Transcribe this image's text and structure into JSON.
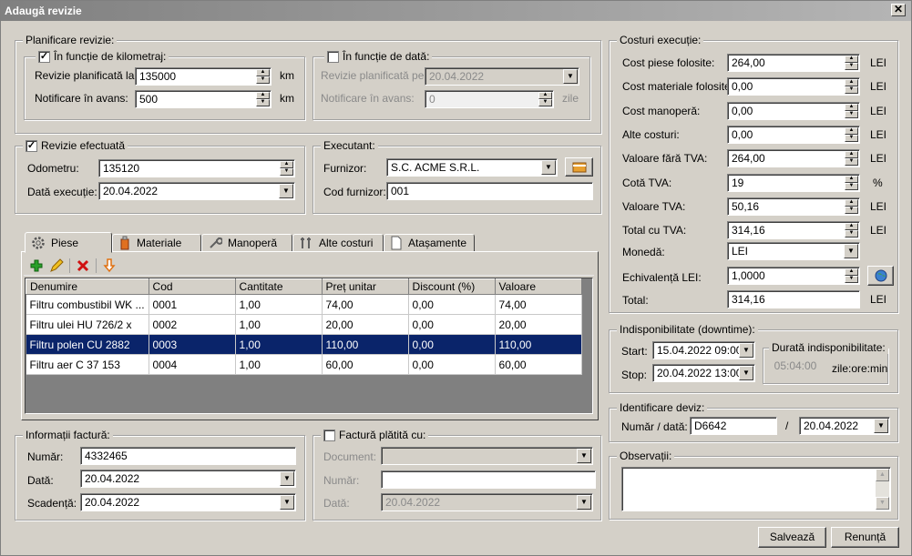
{
  "window": {
    "title": "Adaugă revizie",
    "close": "✕"
  },
  "planificare": {
    "title": "Planificare revizie:",
    "km": {
      "title": "În funcție de kilometraj:",
      "checked": "✓",
      "revizie_label": "Revizie planificată la:",
      "revizie_value": "135000",
      "revizie_unit": "km",
      "notificare_label": "Notificare în avans:",
      "notificare_value": "500",
      "notificare_unit": "km"
    },
    "data": {
      "title": "În funcție de dată:",
      "checked": "",
      "revizie_label": "Revizie planificată pe:",
      "revizie_value": "20.04.2022",
      "notificare_label": "Notificare în avans:",
      "notificare_value": "0",
      "notificare_unit": "zile"
    }
  },
  "efectuata": {
    "title": "Revizie efectuată",
    "checked": "✓",
    "odometru_label": "Odometru:",
    "odometru_value": "135120",
    "data_label": "Dată execuție:",
    "data_value": "20.04.2022"
  },
  "executant": {
    "title": "Executant:",
    "furnizor_label": "Furnizor:",
    "furnizor_value": "S.C. ACME S.R.L.",
    "cod_label": "Cod furnizor:",
    "cod_value": "001"
  },
  "tabs": [
    {
      "label": "Piese",
      "icon": "gear-icon"
    },
    {
      "label": "Materiale",
      "icon": "can-icon"
    },
    {
      "label": "Manoperă",
      "icon": "wrench-icon"
    },
    {
      "label": "Alte costuri",
      "icon": "tools-icon"
    },
    {
      "label": "Atașamente",
      "icon": "document-icon"
    }
  ],
  "grid": {
    "columns": [
      "Denumire",
      "Cod",
      "Cantitate",
      "Preț unitar",
      "Discount (%)",
      "Valoare"
    ],
    "rows": [
      [
        "Filtru combustibil WK ...",
        "0001",
        "1,00",
        "74,00",
        "0,00",
        "74,00"
      ],
      [
        "Filtru ulei HU 726/2 x",
        "0002",
        "1,00",
        "20,00",
        "0,00",
        "20,00"
      ],
      [
        "Filtru polen CU 2882",
        "0003",
        "1,00",
        "110,00",
        "0,00",
        "110,00"
      ],
      [
        "Filtru aer C 37 153",
        "0004",
        "1,00",
        "60,00",
        "0,00",
        "60,00"
      ]
    ],
    "selected_row": 2
  },
  "factura": {
    "title": "Informații factură:",
    "numar_label": "Număr:",
    "numar_value": "4332465",
    "data_label": "Dată:",
    "data_value": "20.04.2022",
    "scadenta_label": "Scadență:",
    "scadenta_value": "20.04.2022"
  },
  "platita": {
    "title": "Factură plătită cu:",
    "checked": "",
    "document_label": "Document:",
    "document_value": "",
    "numar_label": "Număr:",
    "numar_value": "",
    "data_label": "Dată:",
    "data_value": "20.04.2022"
  },
  "costuri": {
    "title": "Costuri execuție:",
    "rows": [
      {
        "label": "Cost piese folosite:",
        "value": "264,00",
        "unit": "LEI"
      },
      {
        "label": "Cost materiale folosite:",
        "value": "0,00",
        "unit": "LEI"
      },
      {
        "label": "Cost manoperă:",
        "value": "0,00",
        "unit": "LEI"
      },
      {
        "label": "Alte costuri:",
        "value": "0,00",
        "unit": "LEI"
      },
      {
        "label": "Valoare fără TVA:",
        "value": "264,00",
        "unit": "LEI"
      },
      {
        "label": "Cotă TVA:",
        "value": "19",
        "unit": "%"
      },
      {
        "label": "Valoare TVA:",
        "value": "50,16",
        "unit": "LEI"
      },
      {
        "label": "Total cu TVA:",
        "value": "314,16",
        "unit": "LEI"
      }
    ],
    "moneda_label": "Monedă:",
    "moneda_value": "LEI",
    "echiv_label": "Echivalență LEI:",
    "echiv_value": "1,0000",
    "total_label": "Total:",
    "total_value": "314,16",
    "total_unit": "LEI"
  },
  "downtime": {
    "title": "Indisponibilitate (downtime):",
    "start_label": "Start:",
    "start_value": "15.04.2022 09:00",
    "stop_label": "Stop:",
    "stop_value": "20.04.2022 13:00",
    "durata_title": "Durată indisponibilitate:",
    "durata_value": "05:04:00",
    "durata_unit": "zile:ore:min"
  },
  "deviz": {
    "title": "Identificare deviz:",
    "label": "Număr / dată:",
    "numar_value": "D6642",
    "separator": "/",
    "data_value": "20.04.2022"
  },
  "observatii": {
    "title": "Observații:",
    "value": ""
  },
  "buttons": {
    "save": "Salvează",
    "cancel": "Renunță"
  }
}
